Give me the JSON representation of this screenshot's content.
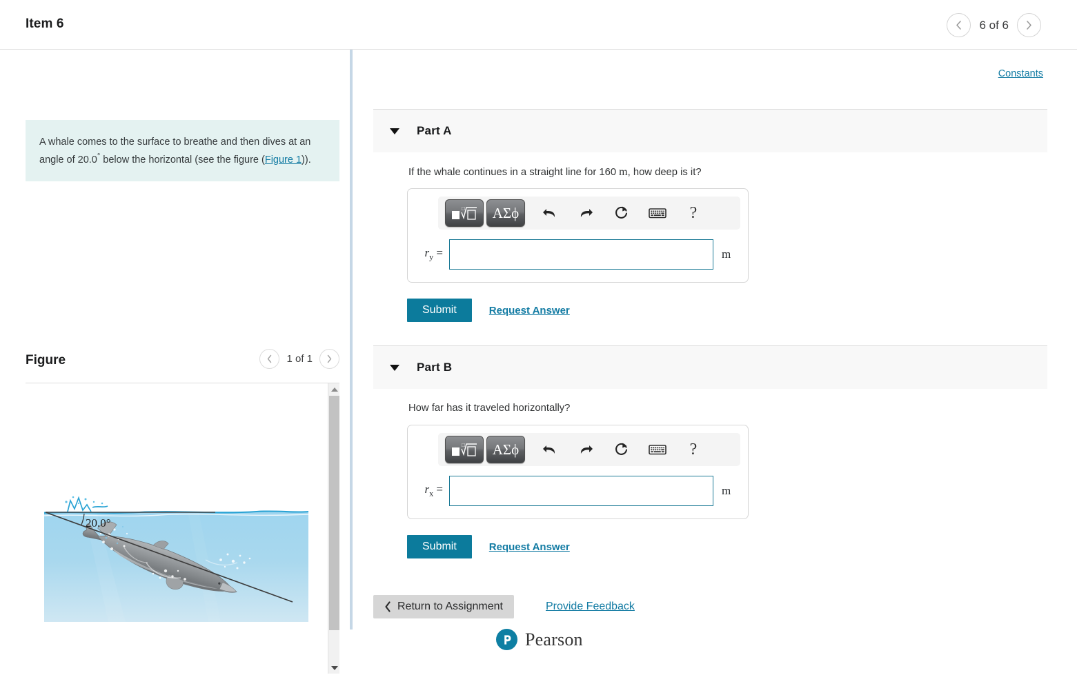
{
  "header": {
    "item_title": "Item 6",
    "pager_label": "6 of 6",
    "prev_icon": "chevron-left-icon",
    "next_icon": "chevron-right-icon"
  },
  "left_panel": {
    "problem_text_part1": "A whale comes to the surface to breathe and then dives at an angle of 20.0",
    "degree_symbol": "°",
    "problem_text_part2": " below the horizontal (see the figure (",
    "figure_link": "Figure 1",
    "problem_text_part3": ")).",
    "figure_title": "Figure",
    "figure_count": "1 of 1",
    "figure_prev_icon": "chevron-left-icon",
    "figure_next_icon": "chevron-right-icon",
    "figure_angle_label": "20.0°",
    "scrollbar_up_icon": "triangle-up-icon",
    "scrollbar_down_icon": "triangle-down-icon"
  },
  "right_panel": {
    "constants_link": "Constants",
    "parts": [
      {
        "label": "Part A",
        "question": "If the whale continues in a straight line for 160 ",
        "question_unit": "m",
        "question_tail": ", how deep is it?",
        "variable": "r",
        "variable_sub": "y",
        "equals": "=",
        "input_value": "",
        "unit": "m",
        "submit_label": "Submit",
        "request_answer_label": "Request Answer",
        "toolbar": [
          {
            "name": "math-template-button",
            "glyph": "■√□"
          },
          {
            "name": "greek-symbols-button",
            "glyph": "ΑΣϕ"
          },
          {
            "name": "undo-button",
            "glyph": "undo-arrow-icon"
          },
          {
            "name": "redo-button",
            "glyph": "redo-arrow-icon"
          },
          {
            "name": "reset-button",
            "glyph": "reset-circular-arrow-icon"
          },
          {
            "name": "keyboard-button",
            "glyph": "keyboard-icon"
          },
          {
            "name": "help-button",
            "glyph": "?"
          }
        ]
      },
      {
        "label": "Part B",
        "question": "How far has it traveled horizontally?",
        "question_unit": "",
        "question_tail": "",
        "variable": "r",
        "variable_sub": "x",
        "equals": "=",
        "input_value": "",
        "unit": "m",
        "submit_label": "Submit",
        "request_answer_label": "Request Answer",
        "toolbar": [
          {
            "name": "math-template-button",
            "glyph": "■√□"
          },
          {
            "name": "greek-symbols-button",
            "glyph": "ΑΣϕ"
          },
          {
            "name": "undo-button",
            "glyph": "undo-arrow-icon"
          },
          {
            "name": "redo-button",
            "glyph": "redo-arrow-icon"
          },
          {
            "name": "reset-button",
            "glyph": "reset-circular-arrow-icon"
          },
          {
            "name": "keyboard-button",
            "glyph": "keyboard-icon"
          },
          {
            "name": "help-button",
            "glyph": "?"
          }
        ]
      }
    ],
    "return_button": "Return to Assignment",
    "provide_feedback": "Provide Feedback",
    "brand": "Pearson"
  },
  "colors": {
    "accent_teal": "#0c7b9c",
    "link_blue": "#127ba3",
    "prompt_bg": "#e4f2f1",
    "band_bg": "#f8f8f8",
    "divider_blue": "#c5d7e6",
    "return_btn_bg": "#d6d6d6"
  }
}
